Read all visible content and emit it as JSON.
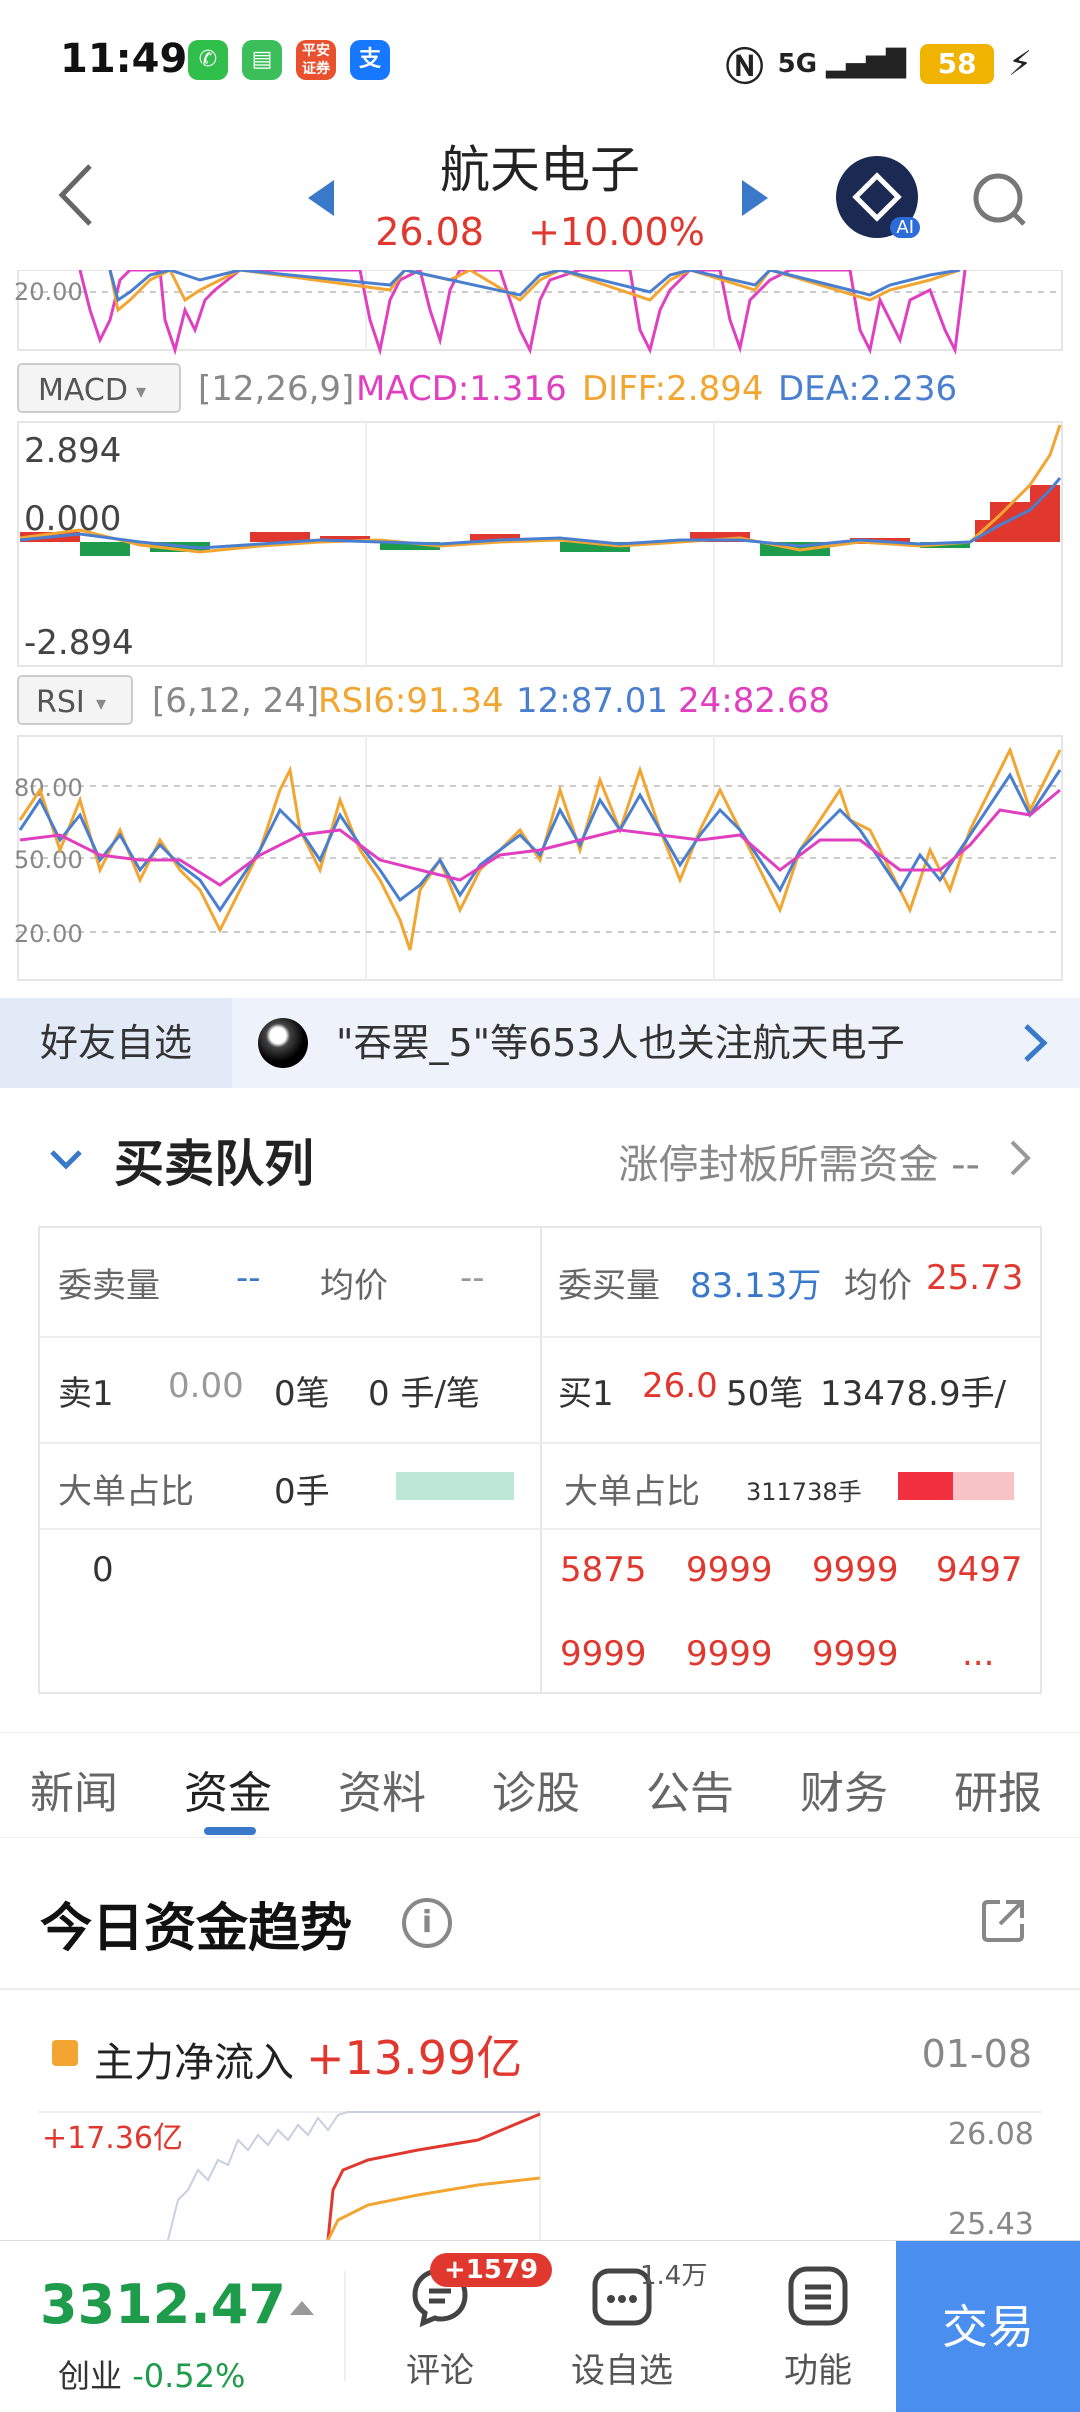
{
  "status": {
    "time": "11:49",
    "battery": "58",
    "network": "5G"
  },
  "header": {
    "title": "航天电子",
    "price": "26.08",
    "change": "+10.00%"
  },
  "top_chart": {
    "gridline_label": "20.00"
  },
  "macd": {
    "selector": "MACD",
    "params": "[12,26,9]",
    "macd": "MACD:1.316",
    "diff": "DIFF:2.894",
    "dea": "DEA:2.236",
    "ymax": "2.894",
    "ymid": "0.000",
    "ymin": "-2.894"
  },
  "rsi": {
    "selector": "RSI",
    "params": "[6,12, 24]",
    "rsi6": "RSI6:91.34",
    "rsi12": "12:87.01",
    "rsi24": "24:82.68",
    "ticks": [
      "80.00",
      "50.00",
      "20.00"
    ]
  },
  "friends": {
    "tag": "好友自选",
    "message": "\"吞罢_5\"等653人也关注航天电子"
  },
  "queue": {
    "title": "买卖队列",
    "right_text": "涨停封板所需资金 --",
    "sell": {
      "vol_label": "委卖量",
      "vol_value": "--",
      "avg_label": "均价",
      "avg_value": "--",
      "level_label": "卖1",
      "level_price": "0.00",
      "level_count": "0笔",
      "level_per": "0 手/笔",
      "big_label": "大单占比",
      "big_value": "0手",
      "orders": [
        "0"
      ]
    },
    "buy": {
      "vol_label": "委买量",
      "vol_value": "83.13万",
      "avg_label": "均价",
      "avg_value": "25.73",
      "level_label": "买1",
      "level_price": "26.0",
      "level_count": "50笔",
      "level_per": "13478.9手/",
      "big_label": "大单占比",
      "big_value": "311738手",
      "orders": [
        "5875",
        "9999",
        "9999",
        "9497",
        "9999",
        "9999",
        "9999",
        "..."
      ]
    }
  },
  "tabs": [
    "新闻",
    "资金",
    "资料",
    "诊股",
    "公告",
    "财务",
    "研报"
  ],
  "fund": {
    "title": "今日资金趋势",
    "main_label": "主力净流入",
    "main_value": "+13.99亿",
    "date": "01-08",
    "chart_max": "+17.36亿",
    "price_top": "26.08",
    "price_mid": "25.43"
  },
  "bottom": {
    "index_value": "3312.47",
    "index_name": "创业",
    "index_change": "-0.52%",
    "comment_label": "评论",
    "comment_badge": "+1579",
    "watch_label": "设自选",
    "watch_count": "1.4万",
    "func_label": "功能",
    "trade_label": "交易"
  },
  "colors": {
    "red": "#e0382f",
    "green": "#1e9b4b",
    "blue": "#3a78c9",
    "orange": "#f2a531",
    "magenta": "#e040c0"
  }
}
